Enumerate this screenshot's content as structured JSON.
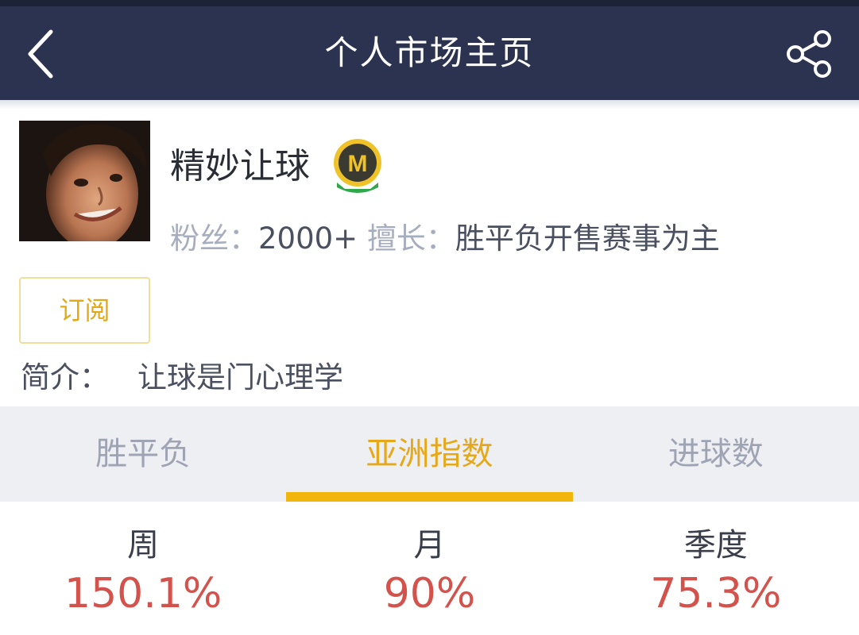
{
  "header": {
    "title": "个人市场主页",
    "back_icon": "chevron-left-icon",
    "share_icon": "share-icon"
  },
  "profile": {
    "name": "精妙让球",
    "badge_letter": "M",
    "fans_label": "粉丝：",
    "fans_value": "2000+",
    "specialty_label": "擅长：",
    "specialty_value": "胜平负开售赛事为主",
    "subscribe_label": "订阅",
    "intro_label": "简介：",
    "intro_value": "让球是门心理学"
  },
  "tabs": [
    {
      "label": "胜平负",
      "active": false
    },
    {
      "label": "亚洲指数",
      "active": true
    },
    {
      "label": "进球数",
      "active": false
    }
  ],
  "returns": [
    {
      "period": "周",
      "value": "150.1%"
    },
    {
      "period": "月",
      "value": "90%"
    },
    {
      "period": "季度",
      "value": "75.3%"
    }
  ],
  "colors": {
    "navbar": "#2b3350",
    "accent": "#f2b50b",
    "return_value": "#d4524c"
  }
}
